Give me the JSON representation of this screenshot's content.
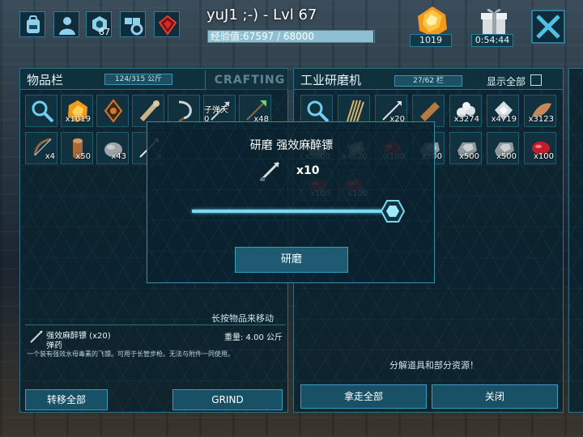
{
  "top_bar": {
    "player_name": "yuJ1 ;-) - Lvl 67",
    "xp_text": "经验值:67597 / 68000",
    "xp_progress": 0.994,
    "engram_count": "87",
    "ember_count": "1019",
    "gift_timer": "0:54:44",
    "icons": [
      "backpack-icon",
      "character-icon",
      "engrams-icon",
      "tribe-settings-icon",
      "element-crystal-icon",
      "close-icon"
    ]
  },
  "inventory": {
    "title": "物品栏",
    "weight": "124/315 公斤",
    "crafting_tab": "CRAFTING",
    "slots_row1": [
      {
        "icon": "search-icon",
        "qty": ""
      },
      {
        "icon": "amber-ore-icon",
        "qty": "x1019"
      },
      {
        "icon": "compass-icon",
        "qty": ""
      },
      {
        "icon": "bone-club-icon",
        "qty": ""
      },
      {
        "icon": "sickle-icon",
        "qty": ""
      },
      {
        "icon": "tranq-dart-icon",
        "qty": "子弹天 0"
      },
      {
        "icon": "spear-arrow-icon",
        "qty": "x48"
      }
    ],
    "slots_row2": [
      {
        "icon": "bow-icon",
        "qty": "x4"
      },
      {
        "icon": "wood-icon",
        "qty": "x50"
      },
      {
        "icon": "stone-icon",
        "qty": "x43"
      },
      {
        "icon": "dart-icon",
        "qty": "x"
      }
    ],
    "drag_hint": "长按物品来移动",
    "selected_item": {
      "name": "强效麻醉镖 (x20)",
      "type": "弹药",
      "weight": "重量: 4.00 公斤",
      "description": "一个装有强效水母毒素的飞镖。可用于长管步枪。无法与附件一同使用。"
    },
    "transfer_all": "转移全部",
    "grind": "GRIND"
  },
  "grinder": {
    "title": "工业研磨机",
    "weight": "27/62 栏",
    "show_all": "显示全部",
    "slots": [
      {
        "icon": "search-icon",
        "qty": ""
      },
      {
        "icon": "thatch-icon",
        "qty": ""
      },
      {
        "icon": "dart-icon",
        "qty": "x20"
      },
      {
        "icon": "wood-plank-icon",
        "qty": ""
      },
      {
        "icon": "pearl-icon",
        "qty": "x3274"
      },
      {
        "icon": "silica-icon",
        "qty": "x4719"
      },
      {
        "icon": "hide-icon",
        "qty": "x3123"
      },
      {
        "icon": "stone-icon",
        "qty": "x5000"
      },
      {
        "icon": "metal-icon",
        "qty": "x4020"
      },
      {
        "icon": "meat-icon",
        "qty": "x100"
      },
      {
        "icon": "metal-ingot-icon",
        "qty": "x500"
      },
      {
        "icon": "metal-ingot-icon",
        "qty": "x500"
      },
      {
        "icon": "metal-ingot-icon",
        "qty": "x500"
      },
      {
        "icon": "meat-icon",
        "qty": "x100"
      },
      {
        "icon": "meat-icon",
        "qty": "x100"
      },
      {
        "icon": "meat-icon",
        "qty": "x100"
      }
    ],
    "grind_hint": "分解道具和部分资源！",
    "take_all": "拿走全部",
    "close": "关闭"
  },
  "modal": {
    "title": "研磨 强效麻醉镖",
    "qty": "x10",
    "slider_fraction": 1.0,
    "confirm": "研磨"
  },
  "colors": {
    "accent": "#3a9cc0",
    "panel": "#0a222e",
    "text": "#e6f4f8"
  }
}
